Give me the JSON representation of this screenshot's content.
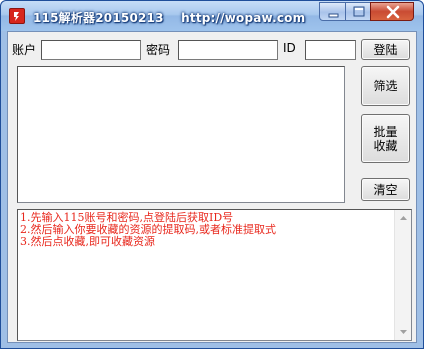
{
  "window": {
    "title": "115解析器20150213    http://wopaw.com",
    "icon": "app-icon-red"
  },
  "controls": {
    "minimize": "minimize-icon",
    "maximize": "maximize-icon",
    "close": "close-icon"
  },
  "login": {
    "account_label": "账户",
    "account_value": "",
    "password_label": "密码",
    "password_value": "",
    "id_label": "ID",
    "id_value": "",
    "login_button": "登陆"
  },
  "actions": {
    "filter_button": "筛选",
    "batch_collect_button": "批量\n收藏",
    "clear_button": "清空"
  },
  "input_area": {
    "value": ""
  },
  "log": {
    "lines": [
      "1.先输入115账号和密码,点登陆后获取ID号",
      "2.然后输入你要收藏的资源的提取码,或者标准提取式",
      "3.然后点收藏,即可收藏资源"
    ]
  },
  "colors": {
    "log_text": "#e8281d",
    "titlebar": "#a8c8ee",
    "close_button": "#c94b33"
  }
}
